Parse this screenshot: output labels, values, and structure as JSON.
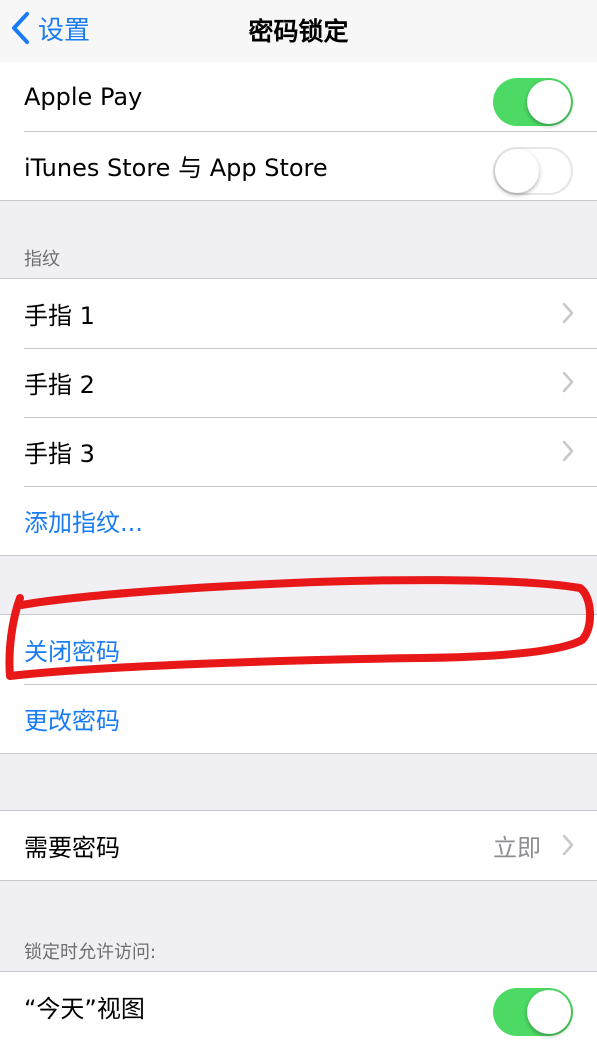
{
  "nav": {
    "back_label": "设置",
    "title": "密码锁定"
  },
  "payments": {
    "apple_pay": {
      "label": "Apple Pay",
      "enabled": true
    },
    "itunes": {
      "label": "iTunes Store 与 App Store",
      "enabled": false
    }
  },
  "fingerprint": {
    "header": "指纹",
    "fingers": [
      "手指 1",
      "手指 2",
      "手指 3"
    ],
    "add_label": "添加指纹..."
  },
  "passcode": {
    "turn_off": "关闭密码",
    "change": "更改密码"
  },
  "require": {
    "label": "需要密码",
    "value": "立即"
  },
  "lock_access": {
    "header": "锁定时允许访问:",
    "today": {
      "label": "“今天”视图",
      "enabled": true
    }
  },
  "colors": {
    "accent": "#1a7cf4",
    "toggle_on": "#4cd964",
    "annotation": "#e81818"
  },
  "icons": {
    "back": "chevron-left-icon",
    "disclosure": "chevron-right-icon"
  }
}
